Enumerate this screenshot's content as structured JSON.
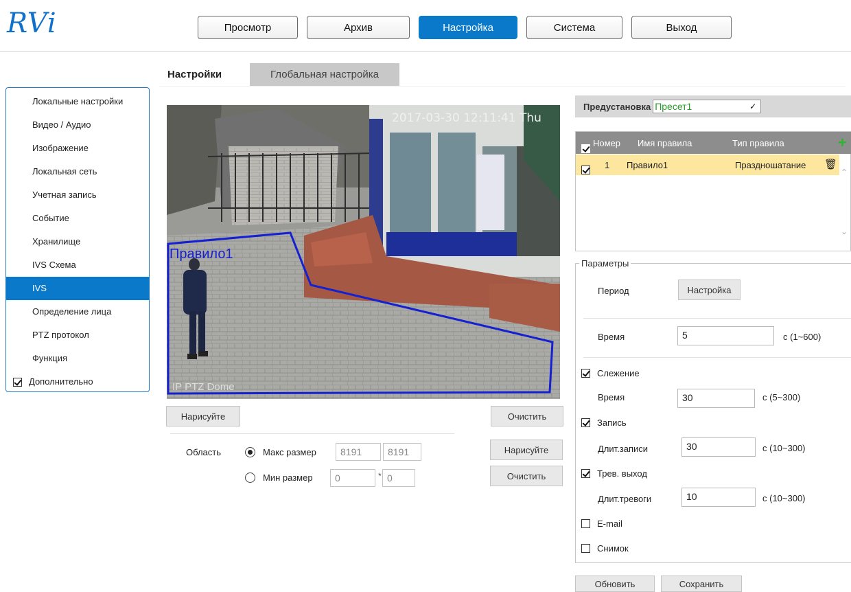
{
  "header": {
    "logo": "RVi",
    "nav": [
      "Просмотр",
      "Архив",
      "Настройка",
      "Система",
      "Выход"
    ],
    "active_nav": "Настройка"
  },
  "sidebar": {
    "items": [
      "Локальные настройки",
      "Видео / Аудио",
      "Изображение",
      "Локальная сеть",
      "Учетная запись",
      "Событие",
      "Хранилище",
      "IVS Схема",
      "IVS",
      "Определение лица",
      "PTZ протокол",
      "Функция"
    ],
    "active_item": "IVS",
    "advanced_label": "Дополнительно",
    "advanced_checked": true
  },
  "tabs": {
    "active": "Настройки",
    "inactive": "Глобальная настройка"
  },
  "video": {
    "timestamp": "2017-03-30 12:11:41 Thu",
    "rule_overlay_label": "Правило1",
    "camera_caption": "IP PTZ Dome"
  },
  "draw": {
    "draw_label": "Нарисуйте",
    "clear_label": "Очистить",
    "area_label": "Область",
    "max_label": "Макс размер",
    "max_w": "8191",
    "max_h": "8191",
    "min_label": "Мин размер",
    "min_w": "0",
    "min_h": "0",
    "size_draw_label": "Нарисуйте",
    "size_clear_label": "Очистить",
    "separator": "*"
  },
  "preset": {
    "label": "Предустановка",
    "value": "Пресет1"
  },
  "rules": {
    "col_number": "Номер",
    "col_name": "Имя правила",
    "col_type": "Тип правила",
    "rows": [
      {
        "number": "1",
        "name": "Правило1",
        "type": "Праздношатание",
        "checked": true
      }
    ]
  },
  "params": {
    "title": "Параметры",
    "period_label": "Период",
    "period_button": "Настройка",
    "time_label": "Время",
    "time_value": "5",
    "time_range": "с (1~600)",
    "tracking_label": "Слежение",
    "tracking_checked": true,
    "tracking_time_label": "Время",
    "tracking_time_value": "30",
    "tracking_time_range": "с (5~300)",
    "record_label": "Запись",
    "record_checked": true,
    "record_dur_label": "Длит.записи",
    "record_dur_value": "30",
    "record_dur_range": "с (10~300)",
    "alarm_label": "Трев. выход",
    "alarm_checked": true,
    "alarm_dur_label": "Длит.тревоги",
    "alarm_dur_value": "10",
    "alarm_dur_range": "с (10~300)",
    "email_label": "E-mail",
    "email_checked": false,
    "snapshot_label": "Снимок",
    "snapshot_checked": false
  },
  "footer": {
    "refresh_label": "Обновить",
    "save_label": "Сохранить"
  },
  "colors": {
    "accent": "#0a79ca",
    "rule_line": "#1520d0",
    "selected_row": "#fde69e",
    "add_icon": "#2db52d"
  }
}
